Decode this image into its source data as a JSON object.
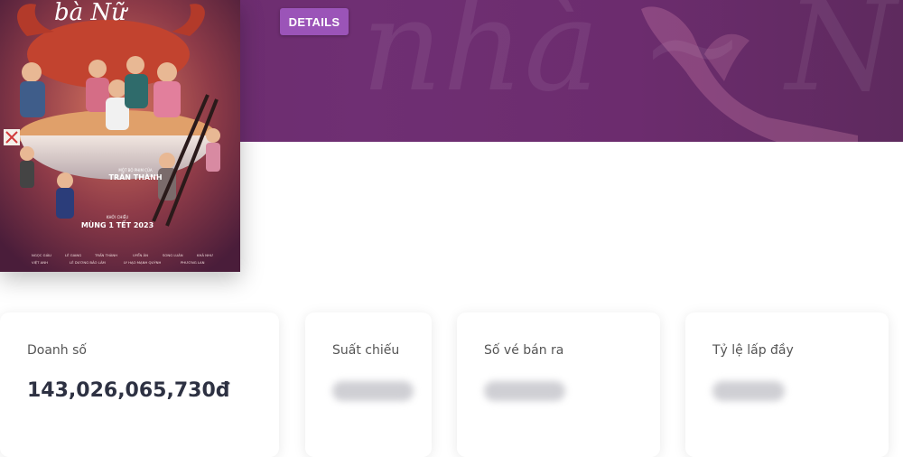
{
  "hero": {
    "details_button": "DETAILS"
  },
  "poster": {
    "title_text": "Nhà Bà Nữ",
    "director_small": "MỘT BỘ PHIM CỦA",
    "director": "TRẤN THÀNH",
    "release_small": "KHỞI CHIẾU",
    "release": "MÙNG 1 TẾT 2023",
    "credits_row1": [
      "NGỌC GIÀU",
      "LÊ GIANG",
      "TRẤN THÀNH",
      "UYỂN ÂN",
      "SONG LUÂN",
      "KHẢ NHƯ"
    ],
    "credits_row2": [
      "VIỆT ANH",
      "LÊ DƯƠNG BẢO LÂM",
      "LY HẠO MẠNH QUỲNH",
      "PHƯƠNG LAN"
    ]
  },
  "stats": [
    {
      "label": "Doanh số",
      "value": "143,026,065,730đ",
      "hidden": false
    },
    {
      "label": "Suất chiếu",
      "value": "",
      "hidden": true
    },
    {
      "label": "Số vé bán ra",
      "value": "",
      "hidden": true
    },
    {
      "label": "Tỷ lệ lấp đầy",
      "value": "",
      "hidden": true
    }
  ],
  "colors": {
    "hero_bg": "#6c2c6e",
    "button_bg": "#9b54b8",
    "value_text": "#2d3142"
  }
}
